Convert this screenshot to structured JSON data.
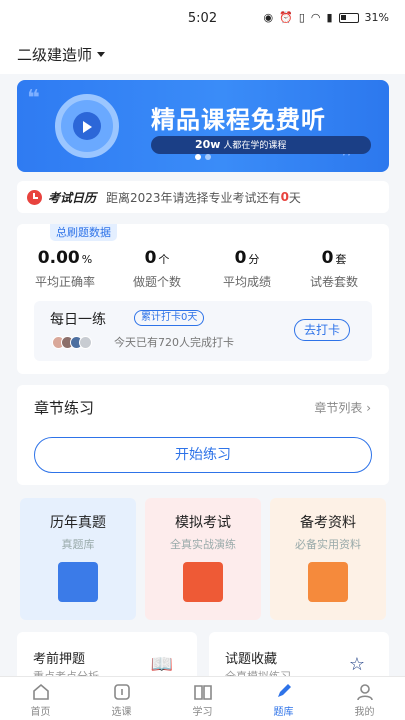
{
  "status_bar": {
    "time": "5:02",
    "battery": "31%"
  },
  "header": {
    "exam_name": "二级建造师"
  },
  "banner": {
    "title": "精品课程免费听",
    "subtitle": "20w",
    "subtitle_small": "人都在学的课程"
  },
  "calendar": {
    "label": "考试日历",
    "text_before": "距离2023年请选择专业考试还有",
    "days": "0",
    "text_after": "天"
  },
  "stats": {
    "tag": "总刷题数据",
    "items": [
      {
        "value": "0.00",
        "unit": "%",
        "label": "平均正确率"
      },
      {
        "value": "0",
        "unit": "个",
        "label": "做题个数"
      },
      {
        "value": "0",
        "unit": "分",
        "label": "平均成绩"
      },
      {
        "value": "0",
        "unit": "套",
        "label": "试卷套数"
      }
    ],
    "daily": {
      "title": "每日一练",
      "badge": "累计打卡0天",
      "people_text": "今天已有720人完成打卡",
      "button": "去打卡"
    }
  },
  "chapter": {
    "title": "章节练习",
    "more": "章节列表 ›",
    "start_button": "开始练习"
  },
  "cards": [
    {
      "title": "历年真题",
      "sub": "真题库",
      "bg": "#e6f0fd",
      "icon": "document-icon",
      "icon_color": "#3b7be8"
    },
    {
      "title": "模拟考试",
      "sub": "全真实战演练",
      "bg": "#fdecec",
      "icon": "exam-icon",
      "icon_color": "#ee5a36"
    },
    {
      "title": "备考资料",
      "sub": "必备实用资料",
      "bg": "#fdf1e6",
      "icon": "folder-icon",
      "icon_color": "#f58a3c"
    }
  ],
  "bottom_cards": [
    {
      "title": "考前押题",
      "sub": "重点考点分析",
      "icon": "book-icon"
    },
    {
      "title": "试题收藏",
      "sub": "全真模拟练习",
      "icon": "star-icon"
    }
  ],
  "tabs": [
    {
      "label": "首页",
      "icon": "home-icon"
    },
    {
      "label": "选课",
      "icon": "course-icon"
    },
    {
      "label": "学习",
      "icon": "study-icon"
    },
    {
      "label": "题库",
      "icon": "question-bank-icon",
      "active": true
    },
    {
      "label": "我的",
      "icon": "profile-icon"
    }
  ]
}
